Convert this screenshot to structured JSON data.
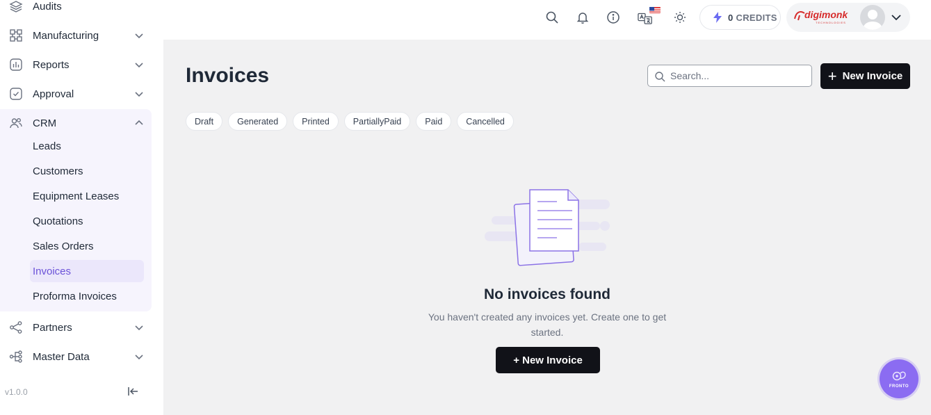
{
  "sidebar": {
    "items": [
      {
        "label": "Audits",
        "icon": "layers-icon",
        "expandable": false
      },
      {
        "label": "Manufacturing",
        "icon": "grid-icon",
        "expandable": true
      },
      {
        "label": "Reports",
        "icon": "chart-icon",
        "expandable": true
      },
      {
        "label": "Approval",
        "icon": "check-square-icon",
        "expandable": true
      },
      {
        "label": "CRM",
        "icon": "users-icon",
        "expandable": true,
        "expanded": true
      },
      {
        "label": "Partners",
        "icon": "share-icon",
        "expandable": true
      },
      {
        "label": "Master Data",
        "icon": "hierarchy-icon",
        "expandable": true
      }
    ],
    "crm_sub": [
      "Leads",
      "Customers",
      "Equipment Leases",
      "Quotations",
      "Sales Orders",
      "Invoices",
      "Proforma Invoices"
    ],
    "active_sub": "Invoices",
    "version": "v1.0.0"
  },
  "topbar": {
    "credits_value": "0",
    "credits_label": "CREDITS",
    "logo_text": "digimonk",
    "logo_sub": "TECHNOLOGIES"
  },
  "main": {
    "title": "Invoices",
    "search_placeholder": "Search...",
    "new_button": "New Invoice",
    "filters": [
      "Draft",
      "Generated",
      "Printed",
      "PartiallyPaid",
      "Paid",
      "Cancelled"
    ],
    "empty_title": "No invoices found",
    "empty_text": "You haven't created any invoices yet. Create one to get started.",
    "empty_button": "+ New Invoice"
  },
  "fab_label": "FRONTO",
  "colors": {
    "accent": "#6b52d8",
    "active_bg": "#ebe7fb",
    "dark_button": "#111218",
    "main_bg": "#f1f1f2",
    "logo": "#d62b2b"
  }
}
